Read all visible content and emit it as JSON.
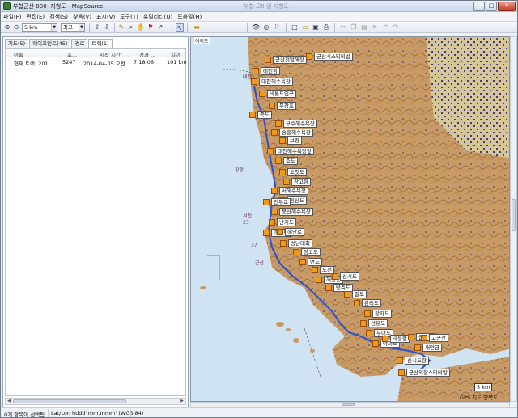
{
  "window": {
    "title": "부합군산-000- 지형도 - MapSource",
    "center_title": "부합 모바일 지형도",
    "buttons": {
      "minimize": "–",
      "maximize": "□",
      "close": "✕"
    }
  },
  "menu": [
    "파일(F)",
    "편집(E)",
    "검색(S)",
    "찾음(V)",
    "표시(V)",
    "도구(T)",
    "유틸리티(U)",
    "도움말(H)"
  ],
  "toolbar": {
    "zoom_value": "5 km",
    "detail_value": "최고",
    "icons": [
      "zoom-in-icon",
      "zoom-out-icon",
      "send-icon",
      "receive-icon",
      "select-icon",
      "zoom-tool-icon",
      "hand-icon",
      "waypoint-tool-icon",
      "route-tool-icon",
      "track-icon",
      "pointer-icon",
      "map-tool-icon",
      "binoculars-icon",
      "find-near-icon",
      "find-next-icon",
      "new-icon",
      "open-icon",
      "save-icon",
      "print-icon",
      "cut-icon",
      "copy-icon",
      "paste-icon",
      "delete-icon",
      "undo-icon",
      "redo-icon"
    ]
  },
  "left_panel": {
    "tabs": [
      "지도(5)",
      "웨이포인트(45)",
      "경로",
      "트랙(1)"
    ],
    "active_tab": 3,
    "columns": [
      "이름",
      "포...",
      "시작 시간",
      "경과 ...",
      "길이"
    ],
    "rows": [
      {
        "name": "현재 트랙: 201...",
        "points": "5247",
        "start": "2014-04-05 오전 ...",
        "elapsed": "7:18:06",
        "length": "101 km"
      }
    ]
  },
  "map": {
    "colors": {
      "sea": "#cfe3f2",
      "land": "#c89a66",
      "land_dark": "#a4703e",
      "track": "#2a4fd0",
      "waypoint": "#f09a1c"
    },
    "scale_label": "5 km",
    "corner_text": "GPS 지도 양쪽도",
    "top_label": "여의도",
    "waypoints": [
      "군산첫발해장",
      "군산시스티비발",
      "대천항",
      "대천해수욕장",
      "비룡도입구",
      "무창포",
      "죽도",
      "구수해수욕장",
      "송흥해수욕장",
      "보령",
      "대천해수욕장앞",
      "조도",
      "도첫도",
      "장고항",
      "서해수욕장",
      "원산도",
      "전부교",
      "몽산해수욕장",
      "난지도",
      "개야도",
      "해안로",
      "성남대회",
      "장고도",
      "연도",
      "도전",
      "해망동",
      "신시도",
      "방축도",
      "말도",
      "관리도",
      "장자도",
      "선유도",
      "무녀도",
      "야미도",
      "비응항",
      "군산항",
      "새만금",
      "고군산",
      "신시도항",
      "군산외항스티비발"
    ],
    "area_labels": [
      "대천",
      "장항",
      "서천",
      "군산",
      "23",
      "37"
    ]
  },
  "status": {
    "selection": "0개 항목이 선택됨",
    "coords": "Lat/Lon hddd°mm.mmm' (WGS 84)"
  }
}
